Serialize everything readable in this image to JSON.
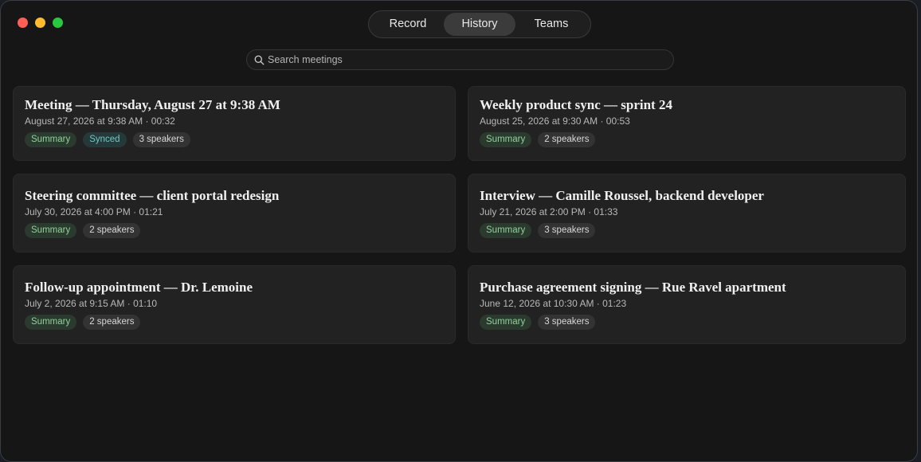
{
  "tabs": [
    {
      "label": "Record",
      "active": false
    },
    {
      "label": "History",
      "active": true
    },
    {
      "label": "Teams",
      "active": false
    }
  ],
  "search": {
    "placeholder": "Search meetings",
    "value": ""
  },
  "meetings": [
    {
      "title": "Meeting — Thursday, August 27 at 9:38 AM",
      "meta": "August 27, 2026 at 9:38 AM · 00:32",
      "summary": "Summary",
      "synced": "Synced",
      "speakers": "3 speakers"
    },
    {
      "title": "Weekly product sync — sprint 24",
      "meta": "August 25, 2026 at 9:30 AM · 00:53",
      "summary": "Summary",
      "speakers": "2 speakers"
    },
    {
      "title": "Steering committee — client portal redesign",
      "meta": "July 30, 2026 at 4:00 PM · 01:21",
      "summary": "Summary",
      "speakers": "2 speakers"
    },
    {
      "title": "Interview — Camille Roussel, backend developer",
      "meta": "July 21, 2026 at 2:00 PM · 01:33",
      "summary": "Summary",
      "speakers": "3 speakers"
    },
    {
      "title": "Follow-up appointment — Dr. Lemoine",
      "meta": "July 2, 2026 at 9:15 AM · 01:10",
      "summary": "Summary",
      "speakers": "2 speakers"
    },
    {
      "title": "Purchase agreement signing — Rue Ravel apartment",
      "meta": "June 12, 2026 at 10:30 AM · 01:23",
      "summary": "Summary",
      "speakers": "3 speakers"
    }
  ],
  "colors": {
    "window_bg": "#161616",
    "card_bg": "#222222",
    "summary_tag": "#8fd19a",
    "synced_tag": "#6fc8c4",
    "close": "#ff5f57",
    "minimize": "#febc2e",
    "maximize": "#28c840"
  },
  "icons": {
    "search": "magnifying-glass-icon"
  }
}
